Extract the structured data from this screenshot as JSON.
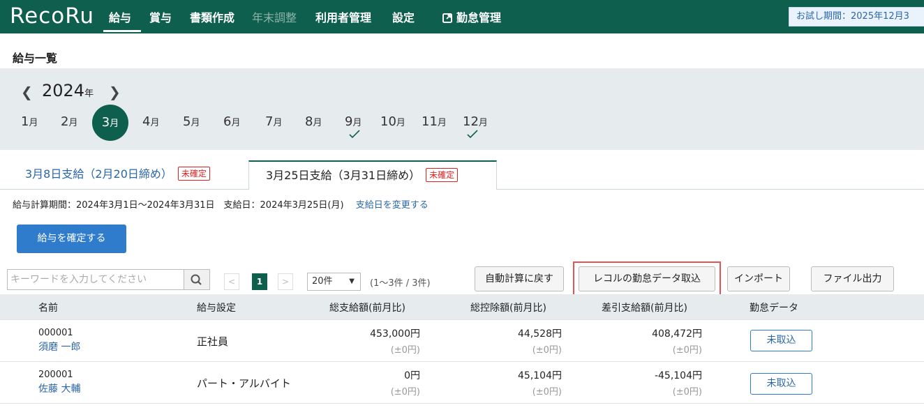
{
  "header": {
    "logo": "RecoRu",
    "nav": [
      "給与",
      "賞与",
      "書類作成",
      "年末調整",
      "利用者管理",
      "設定"
    ],
    "external_link": "勤怠管理",
    "trial": "お試し期間：2025年12月3"
  },
  "page_title": "給与一覧",
  "year": {
    "value": "2024",
    "suffix": "年"
  },
  "months": [
    "1",
    "2",
    "3",
    "4",
    "5",
    "6",
    "7",
    "8",
    "9",
    "10",
    "11",
    "12"
  ],
  "month_suffix": "月",
  "selected_month": "3",
  "checked_months": [
    "9",
    "12"
  ],
  "tabs": [
    {
      "label": "3月8日支給（2月20日締め）",
      "badge": "未確定"
    },
    {
      "label": "3月25日支給（3月31日締め）",
      "badge": "未確定"
    }
  ],
  "period": {
    "text": "給与計算期間：2024年3月1日〜2024年3月31日　支給日：2024年3月25日(月)",
    "link": "支給日を変更する"
  },
  "confirm_button": "給与を確定する",
  "toolbar": {
    "search_placeholder": "キーワードを入力してください",
    "pager_prev": "<",
    "pager_current": "1",
    "pager_next": ">",
    "per_page": "20件",
    "range": "(1〜3件 / 3件)",
    "auto_calc": "自動計算に戻す",
    "import_attendance": "レコルの勤怠データ取込",
    "import": "インポート",
    "export": "ファイル出力"
  },
  "table": {
    "headers": [
      "名前",
      "給与設定",
      "総支給額(前月比)",
      "総控除額(前月比)",
      "差引支給額(前月比)",
      "勤怠データ"
    ],
    "rows": [
      {
        "code": "000001",
        "name": "須磨 一郎",
        "setting": "正社員",
        "gross": "453,000円",
        "gross_diff": "(±0円)",
        "deduction": "44,528円",
        "deduction_diff": "(±0円)",
        "net": "408,472円",
        "net_diff": "(±0円)",
        "attendance": "未取込"
      },
      {
        "code": "200001",
        "name": "佐藤 大輔",
        "setting": "パート・アルバイト",
        "gross": "0円",
        "gross_diff": "(±0円)",
        "deduction": "45,104円",
        "deduction_diff": "(±0円)",
        "net": "-45,104円",
        "net_diff": "(±0円)",
        "attendance": "未取込"
      }
    ]
  },
  "colors": {
    "brand": "#0f5f4e",
    "link": "#2a66a8",
    "primary_button": "#2f7ccc",
    "alert": "#e02020",
    "highlight": "#e25555"
  }
}
